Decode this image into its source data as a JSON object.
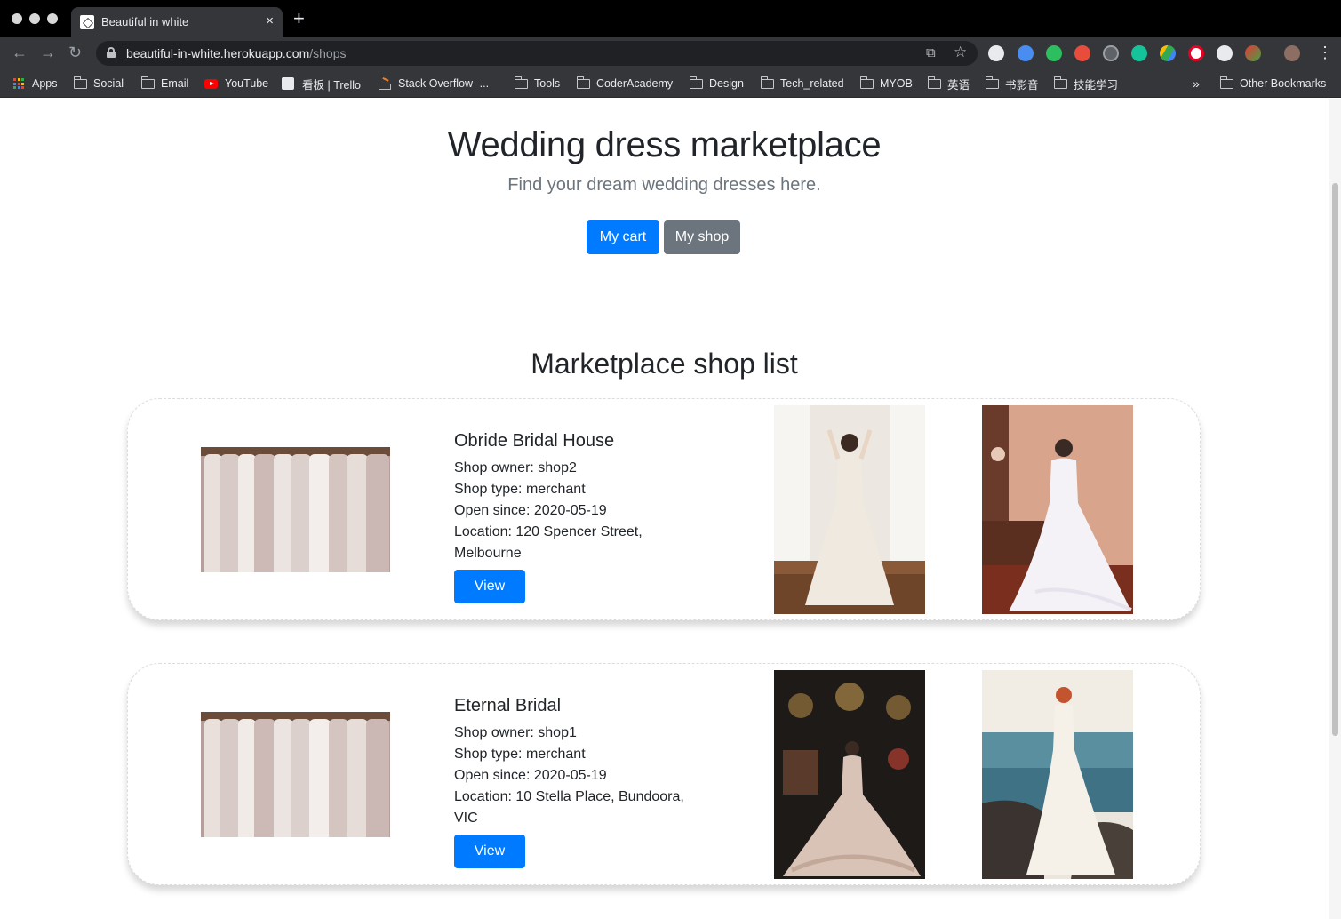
{
  "browser": {
    "tab_title": "Beautiful in white",
    "tab_close": "×",
    "new_tab": "+",
    "url_host": "beautiful-in-white.herokuapp.com",
    "url_path": "/shops",
    "back": "←",
    "forward": "→",
    "reload": "↻",
    "star": "☆",
    "translate": "⧉",
    "menu": "⋮"
  },
  "bookmarks": {
    "items": [
      "Apps",
      "Social",
      "Email",
      "YouTube",
      "看板 | Trello",
      "Stack Overflow -...",
      "Tools",
      "CoderAcademy",
      "Design",
      "Tech_related",
      "MYOB",
      "英语",
      "书影音",
      "技能学习"
    ],
    "overflow": "»",
    "other": "Other Bookmarks"
  },
  "hero": {
    "title": "Wedding dress marketplace",
    "subtitle": "Find your dream wedding dresses here.",
    "cart_button": "My cart",
    "shop_button": "My shop"
  },
  "section": {
    "title": "Marketplace shop list"
  },
  "shops": [
    {
      "name": "Obride Bridal House",
      "owner": "Shop owner: shop2",
      "type": "Shop type: merchant",
      "open": "Open since: 2020-05-19",
      "location": "Location: 120 Spencer Street, Melbourne",
      "view": "View"
    },
    {
      "name": "Eternal Bridal",
      "owner": "Shop owner: shop1",
      "type": "Shop type: merchant",
      "open": "Open since: 2020-05-19",
      "location": "Location: 10 Stella Place, Bundoora, VIC",
      "view": "View"
    }
  ],
  "colors": {
    "primary": "#007bff",
    "secondary": "#6c757d"
  }
}
